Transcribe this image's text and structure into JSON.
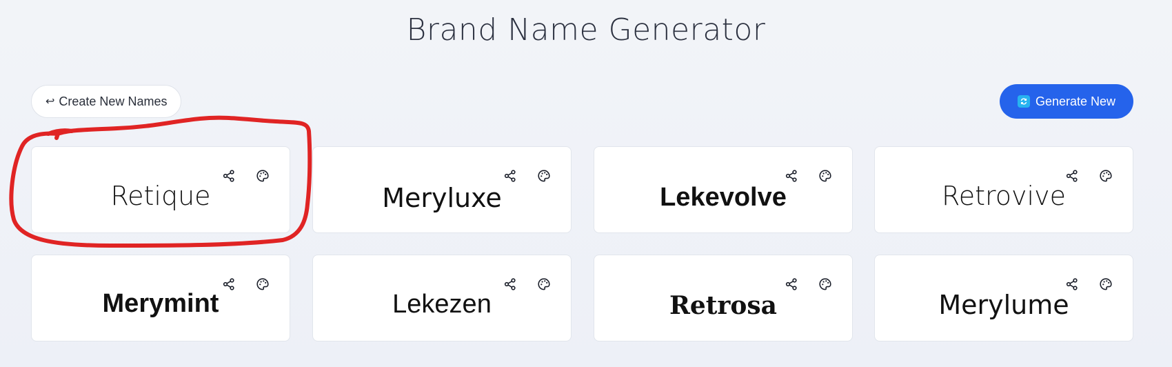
{
  "page": {
    "title": "Brand Name Generator"
  },
  "toolbar": {
    "create_label": "Create New Names",
    "create_glyph": "↩",
    "generate_label": "Generate New",
    "accent_color": "#2563eb",
    "refresh_icon_color": "#27b3f0"
  },
  "names": [
    {
      "label": "Retique",
      "share_icon": "share-icon",
      "palette_icon": "palette-icon"
    },
    {
      "label": "Meryluxe",
      "share_icon": "share-icon",
      "palette_icon": "palette-icon"
    },
    {
      "label": "Lekevolve",
      "share_icon": "share-icon",
      "palette_icon": "palette-icon"
    },
    {
      "label": "Retrovive",
      "share_icon": "share-icon",
      "palette_icon": "palette-icon"
    },
    {
      "label": "Merymint",
      "share_icon": "share-icon",
      "palette_icon": "palette-icon"
    },
    {
      "label": "Lekezen",
      "share_icon": "share-icon",
      "palette_icon": "palette-icon"
    },
    {
      "label": "Retrosa",
      "share_icon": "share-icon",
      "palette_icon": "palette-icon"
    },
    {
      "label": "Merylume",
      "share_icon": "share-icon",
      "palette_icon": "palette-icon"
    }
  ],
  "annotation": {
    "color": "#e02424",
    "target": "Retique"
  }
}
